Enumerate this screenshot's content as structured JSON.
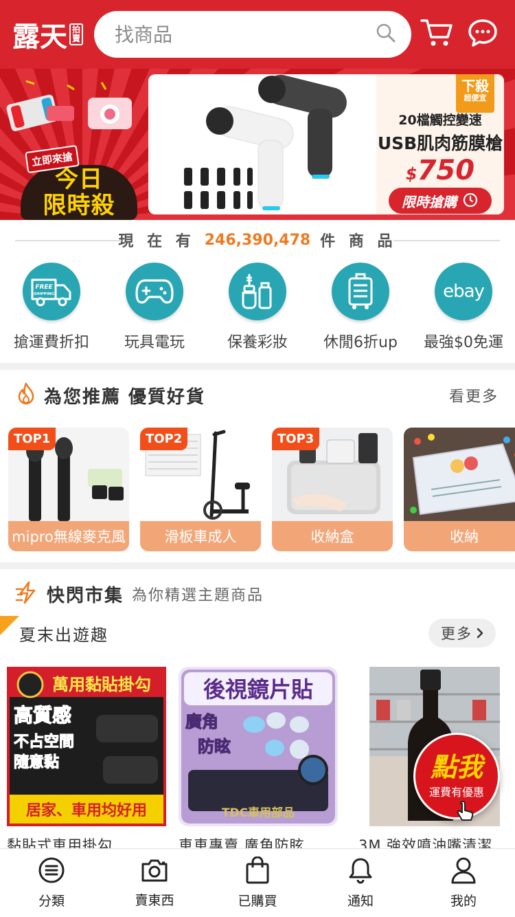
{
  "header": {
    "logo_text": "露天",
    "logo_sub": "拍賣",
    "search_placeholder": "找商品"
  },
  "banner": {
    "left_tag": "立即來搶",
    "left_line1": "今日",
    "left_line2": "限時殺",
    "ad_flag": "下殺",
    "ad_flag_sub": "超便宜",
    "ad_line1": "20檔觸控變速",
    "ad_line2": "USB肌肉筋膜槍",
    "ad_price_symbol": "$",
    "ad_price": "750",
    "ad_button": "限時搶購"
  },
  "stats": {
    "prefix": "現 在 有",
    "count": "246,390,478",
    "suffix": "件 商 品"
  },
  "shortcuts": [
    {
      "label": "搶運費折扣",
      "icon": "free-shipping-truck-icon",
      "icon_text": "FREE SHIPPING"
    },
    {
      "label": "玩具電玩",
      "icon": "gamepad-icon"
    },
    {
      "label": "保養彩妝",
      "icon": "cosmetics-icon"
    },
    {
      "label": "休閒6折up",
      "icon": "luggage-icon"
    },
    {
      "label": "最強$0免運",
      "icon": "ebay-icon",
      "icon_text": "ebay"
    }
  ],
  "recommend": {
    "title": "為您推薦 優質好貨",
    "more": "看更多",
    "items": [
      {
        "rank": "TOP1",
        "label": "mipro無線麥克風"
      },
      {
        "rank": "TOP2",
        "label": "滑板車成人"
      },
      {
        "rank": "TOP3",
        "label": "收納盒"
      },
      {
        "rank": "",
        "label": "收納"
      }
    ]
  },
  "flash": {
    "title": "快閃市集",
    "subtitle": "為你精選主題商品",
    "theme": "夏末出遊趣",
    "more": "更多",
    "products": [
      {
        "name": "黏貼式車用掛勾",
        "img_title": "萬用黏貼掛勾",
        "img_l1": "高質感",
        "img_l2": "不占空間",
        "img_l3": "隨意黏",
        "img_l4": "居家、車用均好用"
      },
      {
        "name": "車車專賣 廣角防眩",
        "img_title": "後視鏡片貼",
        "img_l1": "廣角",
        "img_l2": "防眩",
        "img_brand": "TDC車用部品"
      },
      {
        "name": "3M 強效噴油嘴清潔"
      }
    ]
  },
  "float_button": {
    "line1": "點我",
    "line2": "運費有優惠"
  },
  "bottom_nav": [
    {
      "label": "分類",
      "icon": "menu-list-icon"
    },
    {
      "label": "賣東西",
      "icon": "camera-icon"
    },
    {
      "label": "已購買",
      "icon": "shopping-bag-icon"
    },
    {
      "label": "通知",
      "icon": "bell-icon"
    },
    {
      "label": "我的",
      "icon": "user-icon"
    }
  ],
  "colors": {
    "brand_red": "#d8242c",
    "teal": "#28a6b3",
    "orange": "#ef7a22",
    "top_badge": "#f14e1a"
  }
}
